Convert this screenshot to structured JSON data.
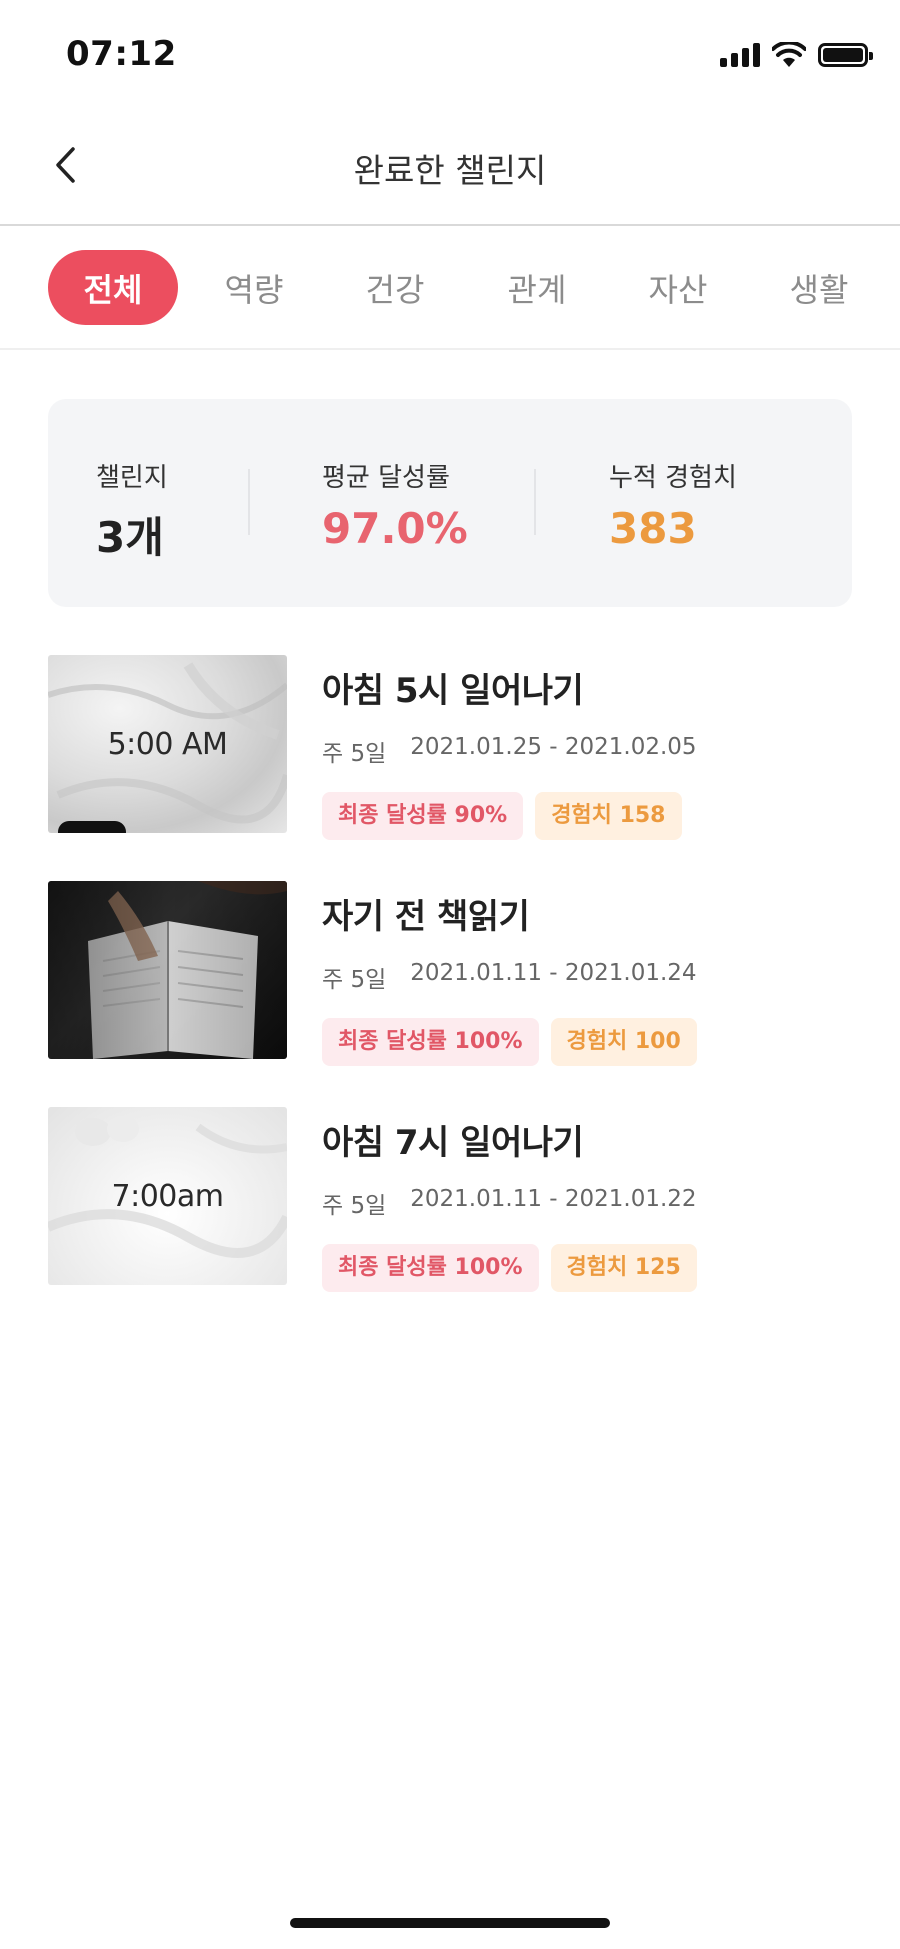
{
  "status_bar": {
    "time": "07:12",
    "icons": [
      "signal-icon",
      "wifi-icon",
      "battery-icon"
    ]
  },
  "header": {
    "title": "완료한 챌린지",
    "back_icon": "chevron-left-icon"
  },
  "tabs": [
    {
      "label": "전체",
      "active": true
    },
    {
      "label": "역량",
      "active": false
    },
    {
      "label": "건강",
      "active": false
    },
    {
      "label": "관계",
      "active": false
    },
    {
      "label": "자산",
      "active": false
    },
    {
      "label": "생활",
      "active": false
    }
  ],
  "summary": {
    "challenges": {
      "label": "챌린지",
      "value": "3개"
    },
    "average_rate": {
      "label": "평균 달성률",
      "value": "97.0%"
    },
    "total_exp": {
      "label": "누적 경험치",
      "value": "383"
    }
  },
  "challenges": [
    {
      "title": "아침 5시 일어나기",
      "frequency": "주 5일",
      "period": "2021.01.25 - 2021.02.05",
      "rate_badge": "최종 달성률 90%",
      "exp_badge": "경험치 158",
      "thumbnail_text": "5:00 AM"
    },
    {
      "title": "자기 전 책읽기",
      "frequency": "주 5일",
      "period": "2021.01.11 - 2021.01.24",
      "rate_badge": "최종 달성률 100%",
      "exp_badge": "경험치 100",
      "thumbnail_text": ""
    },
    {
      "title": "아침 7시 일어나기",
      "frequency": "주 5일",
      "period": "2021.01.11 - 2021.01.22",
      "rate_badge": "최종 달성률 100%",
      "exp_badge": "경험치 125",
      "thumbnail_text": "7:00am"
    }
  ],
  "colors": {
    "accent": "#ec4e5f",
    "rate_text": "#e15766",
    "exp_text": "#ec9a3f",
    "rate_value": "#e8646f",
    "exp_value": "#ec9a3f"
  }
}
